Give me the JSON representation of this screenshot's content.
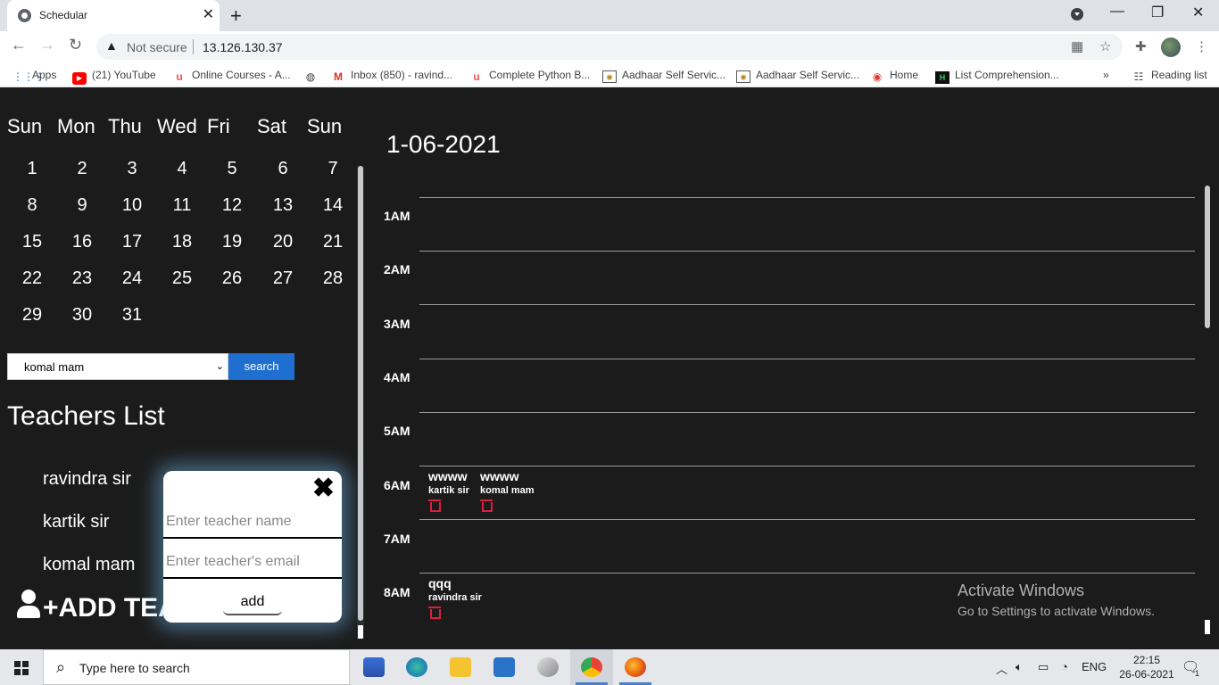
{
  "browser": {
    "tab_title": "Schedular",
    "new_tab": "+",
    "url_warning": "Not secure",
    "url": "13.126.130.37",
    "bookmarks": [
      {
        "label": "Apps",
        "icon": "apps-grid-icon"
      },
      {
        "label": "(21) YouTube",
        "icon": "youtube-icon"
      },
      {
        "label": "Online Courses - A...",
        "icon": "udemy-icon"
      },
      {
        "label": "",
        "icon": "globe-icon"
      },
      {
        "label": "Inbox (850) - ravind...",
        "icon": "gmail-icon"
      },
      {
        "label": "Complete Python B...",
        "icon": "udemy-icon"
      },
      {
        "label": "Aadhaar Self Servic...",
        "icon": "aadhaar-icon"
      },
      {
        "label": "Aadhaar Self Servic...",
        "icon": "aadhaar-icon"
      },
      {
        "label": "Home",
        "icon": "wifi-home-icon"
      },
      {
        "label": "List Comprehension...",
        "icon": "hackerrank-icon"
      }
    ],
    "overflow": "»",
    "reading_list": "Reading list"
  },
  "calendar": {
    "weekdays": [
      "Sun",
      "Mon",
      "Thu",
      "Wed",
      "Fri",
      "Sat",
      "Sun"
    ],
    "days": [
      "1",
      "2",
      "3",
      "4",
      "5",
      "6",
      "7",
      "8",
      "9",
      "10",
      "11",
      "12",
      "13",
      "14",
      "15",
      "16",
      "17",
      "18",
      "19",
      "20",
      "21",
      "22",
      "23",
      "24",
      "25",
      "26",
      "27",
      "28",
      "29",
      "30",
      "31"
    ]
  },
  "teacher_select": {
    "selected": "komal mam",
    "search_label": "search"
  },
  "teachers_list": {
    "title": "Teachers List",
    "items": [
      "ravindra sir",
      "kartik sir",
      "komal mam"
    ],
    "add_label": "+ADD TEACHER"
  },
  "modal": {
    "close": "✖",
    "name_placeholder": "Enter teacher name",
    "email_placeholder": "Enter teacher's email",
    "add_label": "add"
  },
  "schedule": {
    "date": "1-06-2021",
    "hours": [
      "1AM",
      "2AM",
      "3AM",
      "4AM",
      "5AM",
      "6AM",
      "7AM",
      "8AM"
    ],
    "events": [
      {
        "title": "wwww",
        "teacher": "kartik sir",
        "hour": "6AM"
      },
      {
        "title": "wwww",
        "teacher": "komal mam",
        "hour": "6AM"
      },
      {
        "title": "qqq",
        "teacher": "ravindra sir",
        "hour": "8AM"
      }
    ],
    "accent": "#dc1f3c"
  },
  "watermark": {
    "line1": "Activate Windows",
    "line2": "Go to Settings to activate Windows."
  },
  "taskbar": {
    "search_placeholder": "Type here to search",
    "lang": "ENG",
    "time": "22:15",
    "date": "26-06-2021",
    "notifications": "1"
  }
}
